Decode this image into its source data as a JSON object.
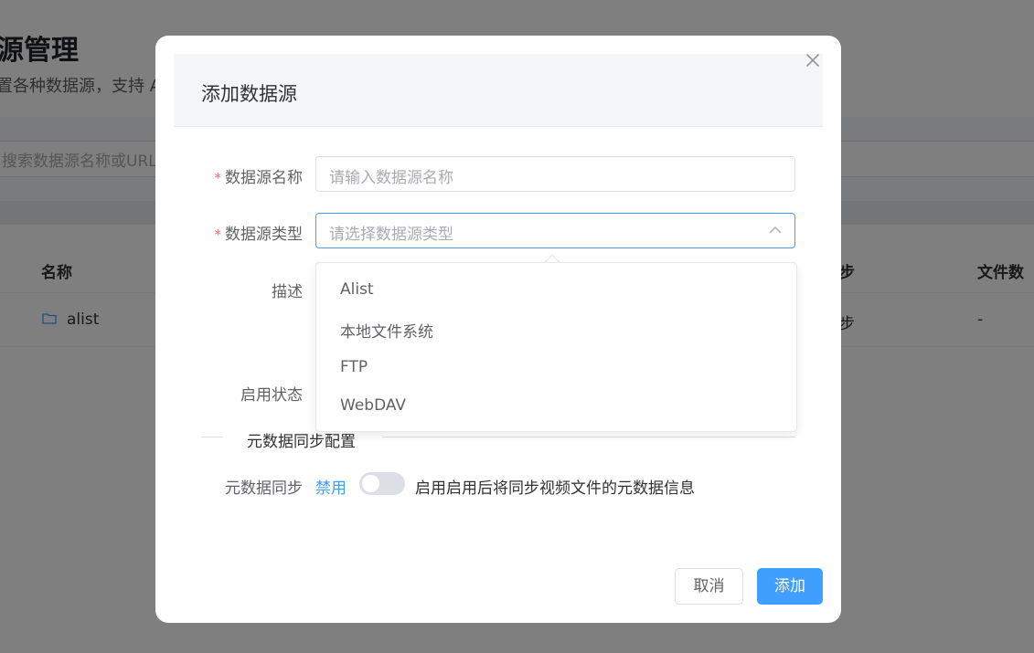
{
  "background": {
    "page_title": "源管理",
    "page_subtitle": "置各种数据源，支持 A",
    "search_placeholder": "搜索数据源名称或URL",
    "columns": [
      "名称",
      "步",
      "文件数"
    ],
    "rows": [
      {
        "name": "alist",
        "sync": "步",
        "files": "-"
      }
    ],
    "folder_icon": "folder-icon"
  },
  "dialog": {
    "title": "添加数据源",
    "close_icon": "close-icon",
    "required_mark": "*",
    "fields": {
      "name": {
        "label": "数据源名称",
        "placeholder": "请输入数据源名称"
      },
      "type": {
        "label": "数据源类型",
        "placeholder": "请选择数据源类型",
        "options": [
          "Alist",
          "本地文件系统",
          "FTP",
          "WebDAV"
        ]
      },
      "description": {
        "label": "描述"
      },
      "enabled": {
        "label": "启用状态"
      }
    },
    "metadata_section": {
      "title": "元数据同步配置",
      "sync_label": "元数据同步",
      "sync_status": "禁用",
      "sync_enabled": false,
      "hint": "启用启用后将同步视频文件的元数据信息"
    },
    "buttons": {
      "cancel": "取消",
      "add": "添加"
    },
    "colors": {
      "primary": "#409eff",
      "required": "#f56c6c",
      "mask": "rgba(0,0,0,0.5)"
    }
  }
}
